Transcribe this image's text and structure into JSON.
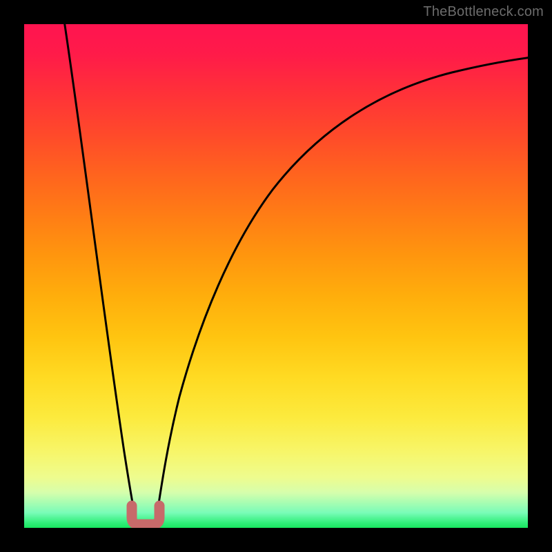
{
  "watermark": "TheBottleneck.com",
  "colors": {
    "background": "#000000",
    "curve": "#000000",
    "marker": "#c76a6a",
    "gradient_top": "#ff1450",
    "gradient_mid": "#ffae0c",
    "gradient_bottom": "#18e55f"
  },
  "chart_data": {
    "type": "line",
    "title": "",
    "xlabel": "",
    "ylabel": "",
    "xlim": [
      0,
      100
    ],
    "ylim": [
      0,
      100
    ],
    "grid": false,
    "legend": false,
    "series": [
      {
        "name": "left-branch",
        "x": [
          8,
          10,
          12,
          14,
          16,
          18,
          19.5,
          21,
          22
        ],
        "values": [
          100,
          86,
          72,
          58,
          44,
          29,
          16,
          6,
          0
        ]
      },
      {
        "name": "right-branch",
        "x": [
          26,
          27,
          28.5,
          30,
          33,
          37,
          42,
          48,
          55,
          63,
          72,
          82,
          92,
          100
        ],
        "values": [
          0,
          8,
          18,
          27,
          39,
          50,
          59,
          66,
          72,
          77,
          81,
          84.5,
          87.5,
          90
        ]
      }
    ],
    "annotations": [
      {
        "name": "min-marker",
        "shape": "u",
        "x_range": [
          21,
          26.5
        ],
        "y": 3,
        "color": "#c76a6a"
      }
    ]
  }
}
